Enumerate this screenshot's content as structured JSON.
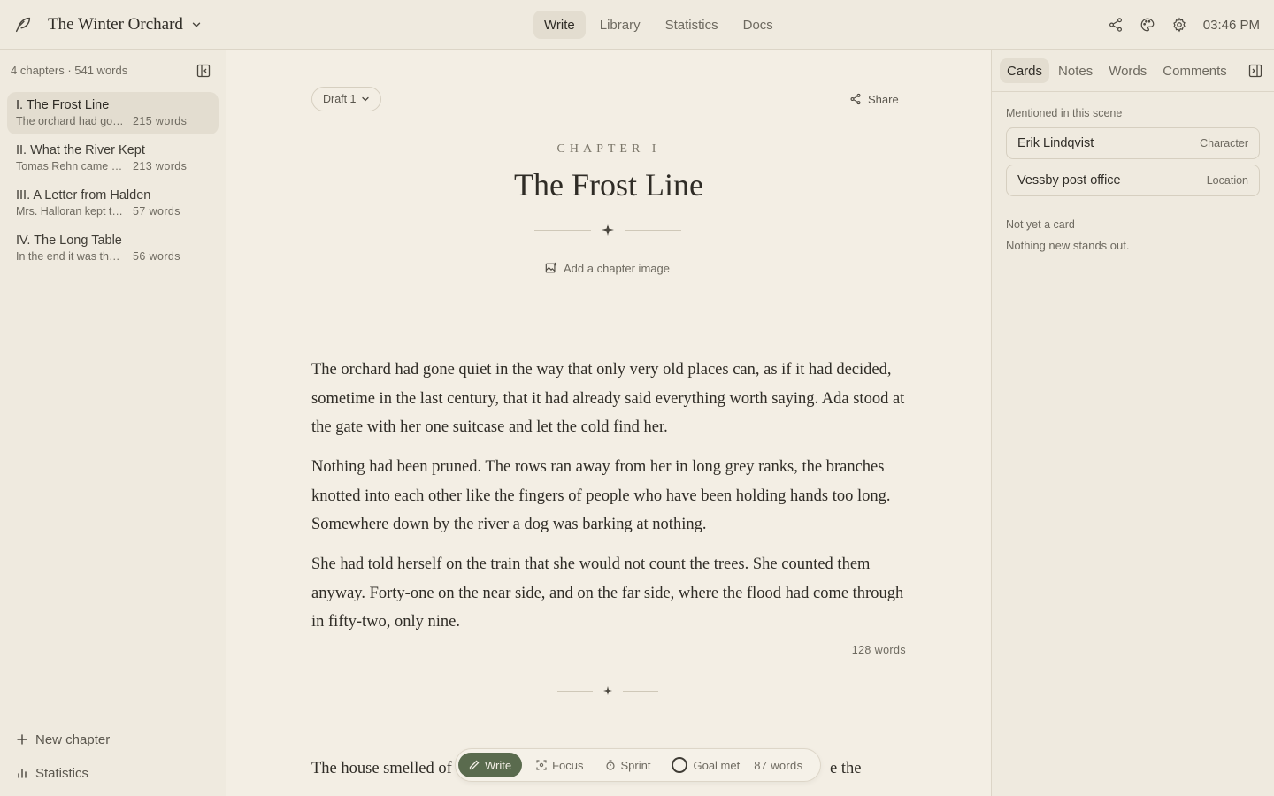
{
  "app": {
    "book_title": "The Winter Orchard",
    "clock": "03:46 PM"
  },
  "nav": {
    "items": [
      {
        "label": "Write",
        "active": true
      },
      {
        "label": "Library",
        "active": false
      },
      {
        "label": "Statistics",
        "active": false
      },
      {
        "label": "Docs",
        "active": false
      }
    ]
  },
  "sidebar": {
    "summary": "4 chapters · 541 words",
    "chapters": [
      {
        "title": "I. The Frost Line",
        "excerpt": "The orchard had gone quiet in the way",
        "words": "215 words",
        "active": true
      },
      {
        "title": "II. What the River Kept",
        "excerpt": "Tomas Rehn came down to the river",
        "words": "213 words",
        "active": false
      },
      {
        "title": "III. A Letter from Halden",
        "excerpt": "Mrs. Halloran kept the letter",
        "words": "57 words",
        "active": false
      },
      {
        "title": "IV. The Long Table",
        "excerpt": "In the end it was the table",
        "words": "56 words",
        "active": false
      }
    ],
    "new_chapter": "New chapter",
    "statistics": "Statistics"
  },
  "editor": {
    "draft": "Draft 1",
    "share": "Share",
    "chapter_label": "CHAPTER I",
    "chapter_title": "The Frost Line",
    "add_image": "Add a chapter image",
    "paragraphs": [
      "The orchard had gone quiet in the way that only very old places can, as if it had decided, sometime in the last century, that it had already said everything worth saying. Ada stood at the gate with her one suitcase and let the cold find her.",
      "Nothing had been pruned. The rows ran away from her in long grey ranks, the branches knotted into each other like the fingers of people who have been holding hands too long. Somewhere down by the river a dog was barking at nothing.",
      "She had told herself on the train that she would not count the trees. She counted them anyway. Forty-one on the near side, and on the far side, where the flood had come through in fifty-two, only nine."
    ],
    "section_words": "128 words",
    "next_line_left": "The house smelled of",
    "next_line_right": "e the"
  },
  "bottom_bar": {
    "write": "Write",
    "focus": "Focus",
    "sprint": "Sprint",
    "goal": "Goal met",
    "word_count": "87 words"
  },
  "right_panel": {
    "tabs": [
      {
        "label": "Cards",
        "active": true
      },
      {
        "label": "Notes",
        "active": false
      },
      {
        "label": "Words",
        "active": false
      },
      {
        "label": "Comments",
        "active": false
      }
    ],
    "mentioned_label": "Mentioned in this scene",
    "cards": [
      {
        "name": "Erik Lindqvist",
        "type": "Character"
      },
      {
        "name": "Vessby post office",
        "type": "Location"
      }
    ],
    "not_yet_label": "Not yet a card",
    "not_yet_text": "Nothing new stands out."
  },
  "colors": {
    "accent": "#5a6b4e",
    "background": "#f2ede3",
    "panel": "#efeadf"
  }
}
